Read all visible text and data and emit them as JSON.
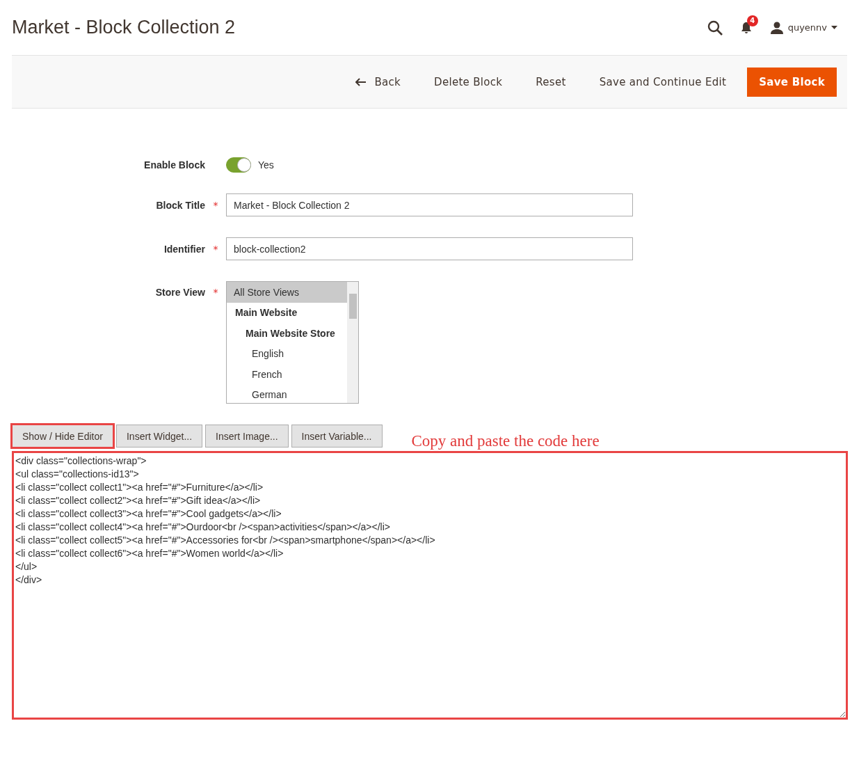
{
  "page_title": "Market - Block Collection 2",
  "header": {
    "notification_count": "4",
    "user": "quyennv"
  },
  "actions": [
    {
      "label": "Back",
      "kind": "back"
    },
    {
      "label": "Delete Block",
      "kind": "plain"
    },
    {
      "label": "Reset",
      "kind": "plain"
    },
    {
      "label": "Save and Continue Edit",
      "kind": "plain"
    },
    {
      "label": "Save Block",
      "kind": "primary"
    }
  ],
  "form": {
    "enable": {
      "label": "Enable Block",
      "on": true,
      "value_label": "Yes"
    },
    "title": {
      "label": "Block Title",
      "required_mark": "*",
      "value": "Market - Block Collection 2"
    },
    "identifier": {
      "label": "Identifier",
      "required_mark": "*",
      "value": "block-collection2"
    },
    "store_view": {
      "label": "Store View",
      "required_mark": "*",
      "options": [
        {
          "label": "All Store Views",
          "kind": "all",
          "selected": true
        },
        {
          "label": "Main Website",
          "kind": "website",
          "selected": false
        },
        {
          "label": "Main Website Store",
          "kind": "store",
          "selected": false
        },
        {
          "label": "English",
          "kind": "view",
          "selected": false
        },
        {
          "label": "French",
          "kind": "view",
          "selected": false
        },
        {
          "label": "German",
          "kind": "view",
          "selected": false
        }
      ]
    }
  },
  "editor_buttons": [
    {
      "label": "Show / Hide Editor",
      "highlighted": true
    },
    {
      "label": "Insert Widget...",
      "highlighted": false
    },
    {
      "label": "Insert Image...",
      "highlighted": false
    },
    {
      "label": "Insert Variable...",
      "highlighted": false
    }
  ],
  "annotation": "Copy and paste the code here",
  "editor": {
    "highlighted": true,
    "lines": [
      "<div class=\"collections-wrap\">",
      "<ul class=\"collections-id13\">",
      "<li class=\"collect collect1\"><a href=\"#\">Furniture</a></li>",
      "<li class=\"collect collect2\"><a href=\"#\">Gift idea</a></li>",
      "<li class=\"collect collect3\"><a href=\"#\">Cool gadgets</a></li>",
      "<li class=\"collect collect4\"><a href=\"#\">Ourdoor<br /><span>activities</span></a></li>",
      "<li class=\"collect collect5\"><a href=\"#\">Accessories for<br /><span>smartphone</span></a></li>",
      "<li class=\"collect collect6\"><a href=\"#\">Women world</a></li>",
      "</ul>",
      "</div>"
    ]
  }
}
